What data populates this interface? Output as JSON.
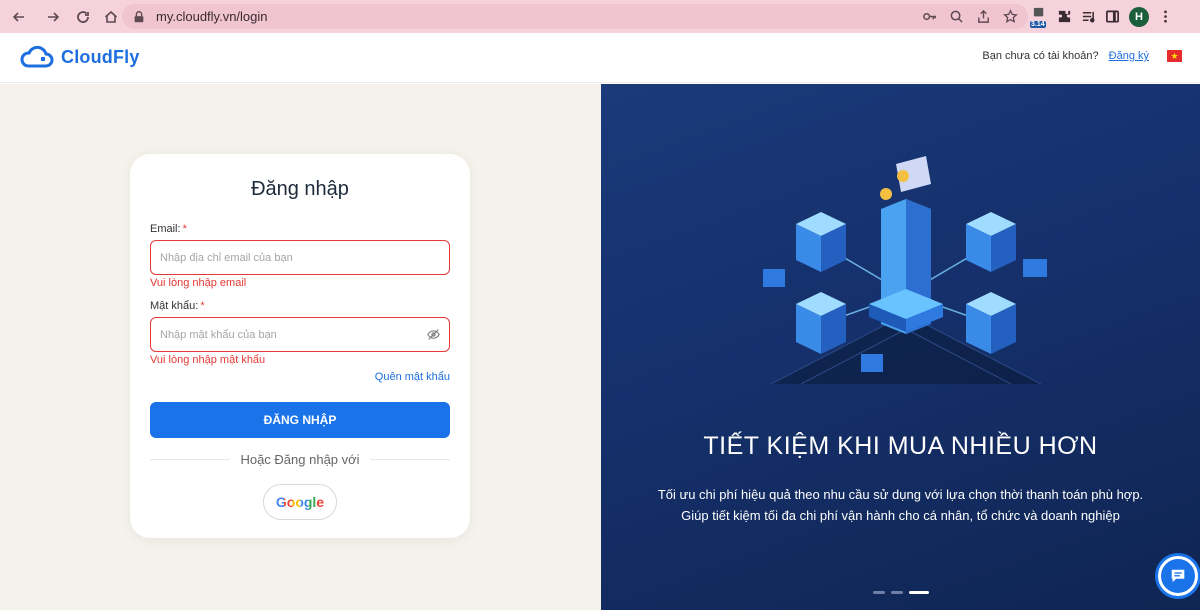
{
  "browser": {
    "url": "my.cloudfly.vn/login",
    "ext_badge": "3.14",
    "profile_initial": "H"
  },
  "header": {
    "brand": "CloudFly",
    "account_prompt": "Bạn chưa có tài khoản?",
    "signup_label": "Đăng ký",
    "flag_glyph": "★"
  },
  "login": {
    "title": "Đăng nhập",
    "email_label": "Email:",
    "email_placeholder": "Nhập địa chỉ email của bạn",
    "email_error": "Vui lòng nhập email",
    "password_label": "Mật khẩu:",
    "password_placeholder": "Nhập mật khẩu của bạn",
    "password_error": "Vui lòng nhập mật khẩu",
    "required_mark": "*",
    "forgot_label": "Quên mật khẩu",
    "submit_label": "ĐĂNG NHẬP",
    "alt_login_label": "Hoặc Đăng nhập với",
    "google_label": "Google"
  },
  "promo": {
    "title": "TIẾT KIỆM KHI MUA NHIỀU HƠN",
    "description_line1": "Tối ưu chi phí hiệu quả theo nhu cầu sử dụng với lựa chọn thời thanh toán phù hợp.",
    "description_line2": "Giúp tiết kiệm tối đa chi phí vận hành cho cá nhân, tổ chức và doanh nghiệp",
    "slide_count": 3,
    "active_slide": 3
  },
  "colors": {
    "brand_blue": "#1a73e8",
    "error_red": "#e53935",
    "left_bg": "#f5f2ec",
    "right_bg": "#15306b",
    "browser_bar": "#f6d3dc"
  }
}
